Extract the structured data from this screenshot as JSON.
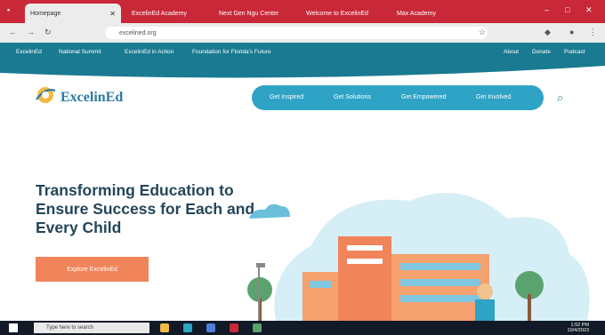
{
  "browser": {
    "tabs": [
      {
        "label": "Homepage",
        "active": true
      },
      {
        "label": "ExcelinEd Academy",
        "active": false
      },
      {
        "label": "Next Gen Ngu Center",
        "active": false
      },
      {
        "label": "Welcome to ExcelinEd",
        "active": false
      },
      {
        "label": "Max Academy",
        "active": false
      }
    ],
    "address": "excelined.org"
  },
  "utility": {
    "left_links": [
      "ExcelinEd",
      "National Summit",
      "ExcelinEd in Action",
      "Foundation for Florida's Future"
    ],
    "right_links": [
      "About",
      "Donate",
      "Podcast"
    ]
  },
  "site": {
    "logo_text": "ExcelinEd",
    "nav": [
      "Get Inspired",
      "Get Solutions",
      "Get Empowered",
      "Get Involved"
    ],
    "headline": "Transforming Education to Ensure Success for Each and Every Child",
    "cta": "Explore ExcelinEd"
  },
  "taskbar": {
    "search_placeholder": "Type here to search",
    "time": "1:52 PM",
    "date": "10/4/2023"
  },
  "colors": {
    "tabbar": "#c82838",
    "utility": "#1a7a91",
    "nav": "#2ea3c5",
    "cta": "#f0845a",
    "headline": "#24455a"
  }
}
